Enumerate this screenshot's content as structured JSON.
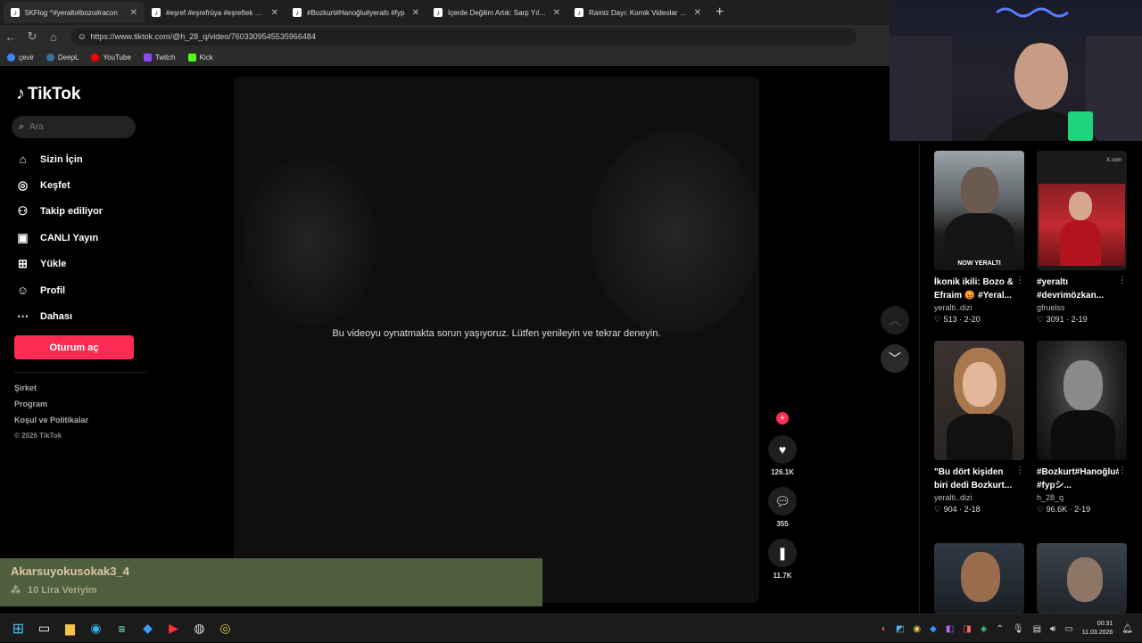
{
  "browser": {
    "tabs": [
      {
        "label": "5KFlog ^#yeraltı#bozo#racon",
        "active": true
      },
      {
        "label": "#eşref #eşrefrüya #eşreftek #nisan",
        "active": false
      },
      {
        "label": "#Bozkurt#Hanoğlu#yeraltı #fyp",
        "active": false
      },
      {
        "label": "İçerde Değilim Artık: Sarp Yılmaz'ı",
        "active": false
      },
      {
        "label": "Ramiz Dayı: Komik Videolar ve Mo",
        "active": false
      }
    ],
    "url": "https://www.tiktok.com/@h_28_q/video/7603309545535966484",
    "bookmarks": [
      {
        "label": "çevir",
        "color": "#4285f4"
      },
      {
        "label": "DeepL",
        "color": "#0f2b46"
      },
      {
        "label": "YouTube",
        "color": "#ff0000"
      },
      {
        "label": "Twitch",
        "color": "#9146ff"
      },
      {
        "label": "Kick",
        "color": "#53fc18"
      }
    ]
  },
  "tiktok": {
    "logo": "TikTok",
    "search_placeholder": "Ara",
    "nav": [
      {
        "label": "Sizin İçin",
        "icon": "home-icon"
      },
      {
        "label": "Keşfet",
        "icon": "compass-icon"
      },
      {
        "label": "Takip ediliyor",
        "icon": "following-icon"
      },
      {
        "label": "CANLI Yayın",
        "icon": "live-icon"
      },
      {
        "label": "Yükle",
        "icon": "upload-icon"
      },
      {
        "label": "Profil",
        "icon": "profile-icon"
      },
      {
        "label": "Dahası",
        "icon": "more-icon"
      }
    ],
    "login_label": "Oturum aç",
    "footer": [
      "Şirket",
      "Program",
      "Koşul ve Politikalar"
    ],
    "copyright": "© 2026 TikTok",
    "video_error": "Bu videoyu oynatmakta sorun yaşıyoruz. Lütfen yenileyin ve tekrar deneyin.",
    "likes": "126.1K",
    "comments": "355",
    "saves": "11.7K",
    "accent": "#fe2c55"
  },
  "related": [
    {
      "title": "İkonik ikili: Bozo & Efraim 😡 #Yeral...",
      "author": "yeralti..dizi",
      "likes": "513",
      "date": "2-20",
      "thumb_text": "NOW YERALTI"
    },
    {
      "title": "#yeraltı #devrimözkan...",
      "author": "gfruelss",
      "likes": "3091",
      "date": "2-19",
      "thumb_text": "X.com"
    },
    {
      "title": "\"Bu dört kişiden biri dedi Bozkurt...",
      "author": "yeralti..dizi",
      "likes": "904",
      "date": "2-18",
      "thumb_text": ""
    },
    {
      "title": "#Bozkurt#Hanoğlu#yeraltı #fypシ...",
      "author": "h_28_q",
      "likes": "96.6K",
      "date": "2-19",
      "thumb_text": ""
    }
  ],
  "chat": {
    "username": "Akarsuyokusokak3_4",
    "message": "10 Lira Veriyim"
  },
  "taskbar": {
    "time": "00:31",
    "date": "11.03.2026"
  }
}
